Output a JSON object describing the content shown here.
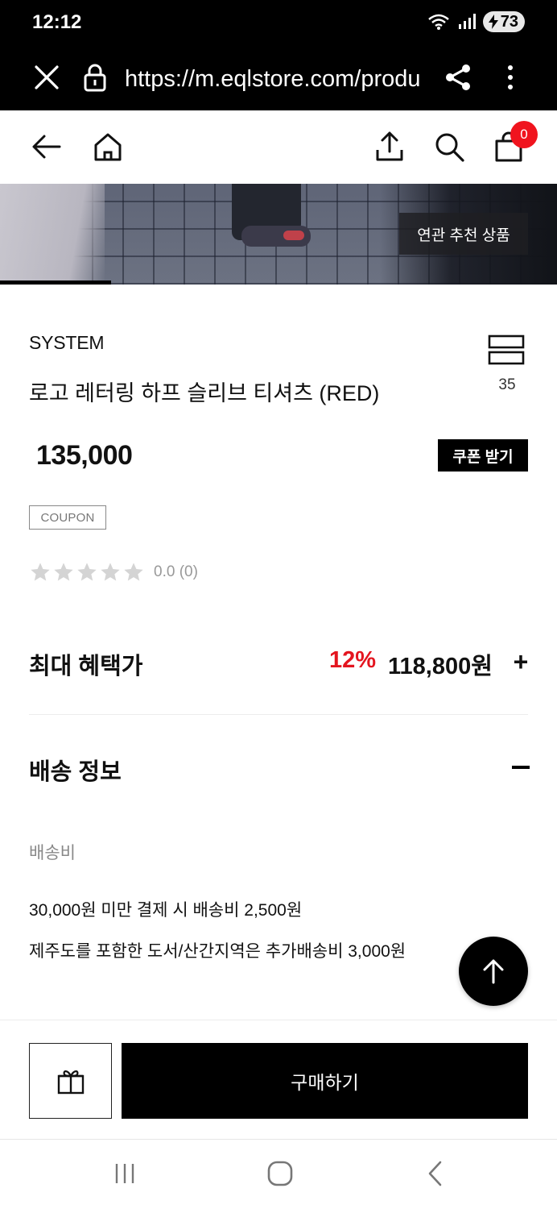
{
  "status_bar": {
    "time": "12:12",
    "battery": "73"
  },
  "browser": {
    "url": "https://m.eqlstore.com/produ"
  },
  "header": {
    "cart_count": "0"
  },
  "hero": {
    "recommend_label": "연관 추천 상품"
  },
  "product": {
    "brand": "SYSTEM",
    "name": "로고 레터링 하프 슬리브 티셔츠 (RED)",
    "like_count": "35",
    "price": "135,000",
    "coupon_button": "쿠폰 받기",
    "coupon_tag": "COUPON",
    "rating_text": "0.0 (0)",
    "rating_value": 0
  },
  "benefit": {
    "label": "최대 혜택가",
    "rate": "12%",
    "price": "118,800원",
    "toggle": "+"
  },
  "shipping": {
    "title": "배송 정보",
    "fee_label": "배송비",
    "line1": "30,000원 미만 결제 시 배송비 2,500원",
    "line2": "제주도를 포함한 도서/산간지역은 추가배송비 3,000원"
  },
  "bottom_bar": {
    "buy_label": "구매하기"
  },
  "colors": {
    "accent_red": "#e4151f",
    "badge_red": "#f0141e",
    "primary": "#000000"
  }
}
